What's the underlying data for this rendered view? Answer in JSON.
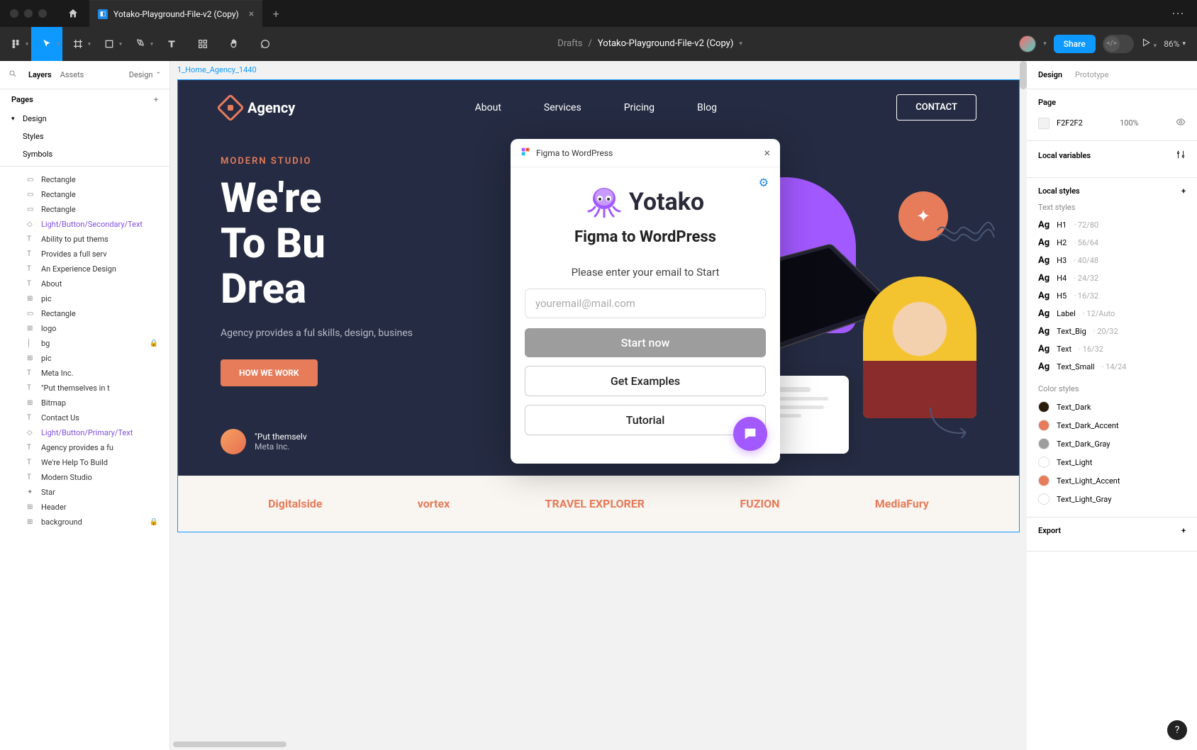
{
  "titlebar": {
    "filename": "Yotako-Playground-File-v2 (Copy)"
  },
  "toolbar": {
    "breadcrumb_root": "Drafts",
    "breadcrumb_sep": "/",
    "filename": "Yotako-Playground-File-v2 (Copy)",
    "share": "Share",
    "zoom": "86%"
  },
  "left_panel": {
    "tabs": {
      "layers": "Layers",
      "assets": "Assets",
      "design": "Design"
    },
    "pages_label": "Pages",
    "pages": [
      {
        "label": "Design",
        "selected": true
      },
      {
        "label": "Styles"
      },
      {
        "label": "Symbols"
      }
    ],
    "layers": [
      {
        "icon": "rect",
        "label": "Rectangle"
      },
      {
        "icon": "rect",
        "label": "Rectangle"
      },
      {
        "icon": "rect",
        "label": "Rectangle"
      },
      {
        "icon": "diamond",
        "label": "Light/Button/Secondary/Text",
        "purple": true
      },
      {
        "icon": "text",
        "label": "Ability to put thems"
      },
      {
        "icon": "text",
        "label": "Provides a full serv"
      },
      {
        "icon": "text",
        "label": "An Experience Design"
      },
      {
        "icon": "text",
        "label": "About"
      },
      {
        "icon": "frame",
        "label": "pic"
      },
      {
        "icon": "rect",
        "label": "Rectangle"
      },
      {
        "icon": "frame",
        "label": "logo"
      },
      {
        "icon": "line",
        "label": "bg",
        "locked": true
      },
      {
        "icon": "frame",
        "label": "pic"
      },
      {
        "icon": "text",
        "label": "Meta Inc."
      },
      {
        "icon": "text",
        "label": "\"Put themselves in t"
      },
      {
        "icon": "frame",
        "label": "Bitmap"
      },
      {
        "icon": "text",
        "label": "Contact Us"
      },
      {
        "icon": "diamond",
        "label": "Light/Button/Primary/Text",
        "purple": true
      },
      {
        "icon": "text",
        "label": "Agency provides a fu"
      },
      {
        "icon": "text",
        "label": "We're Help To Build"
      },
      {
        "icon": "text",
        "label": "Modern Studio"
      },
      {
        "icon": "star",
        "label": "Star"
      },
      {
        "icon": "frame",
        "label": "Header"
      },
      {
        "icon": "frame",
        "label": "background",
        "locked": true
      }
    ]
  },
  "canvas": {
    "frame_label": "1_Home_Agency_1440",
    "nav": {
      "logo": "Agency",
      "links": [
        "About",
        "Services",
        "Pricing",
        "Blog"
      ],
      "contact": "CONTACT"
    },
    "hero": {
      "tag": "MODERN STUDIO",
      "title_l1": "We're",
      "title_l2": "To Bu",
      "title_l3": "Drea",
      "desc": "Agency provides a ful skills, design, busines",
      "cta": "HOW WE WORK"
    },
    "testimonial": {
      "quote": "\"Put themselv",
      "company": "Meta Inc."
    },
    "brands": [
      "Digitalside",
      "vortex",
      "TRAVEL EXPLORER",
      "FUZION",
      "MediaFury"
    ]
  },
  "plugin": {
    "header": "Figma to WordPress",
    "brand": "Yotako",
    "title": "Figma to WordPress",
    "subtitle": "Please enter your email to Start",
    "placeholder": "youremail@mail.com",
    "start": "Start now",
    "examples": "Get Examples",
    "tutorial": "Tutorial"
  },
  "right_panel": {
    "tabs": {
      "design": "Design",
      "prototype": "Prototype"
    },
    "page_label": "Page",
    "bg_hex": "F2F2F2",
    "bg_opacity": "100%",
    "local_vars": "Local variables",
    "local_styles": "Local styles",
    "text_styles_label": "Text styles",
    "text_styles": [
      {
        "name": "H1",
        "meta": "72/80"
      },
      {
        "name": "H2",
        "meta": "56/64"
      },
      {
        "name": "H3",
        "meta": "40/48"
      },
      {
        "name": "H4",
        "meta": "24/32"
      },
      {
        "name": "H5",
        "meta": "16/32"
      },
      {
        "name": "Label",
        "meta": "12/Auto"
      },
      {
        "name": "Text_Big",
        "meta": "20/32"
      },
      {
        "name": "Text",
        "meta": "16/32"
      },
      {
        "name": "Text_Small",
        "meta": "14/24"
      }
    ],
    "color_styles_label": "Color styles",
    "color_styles": [
      {
        "name": "Text_Dark",
        "color": "#2a1a0a"
      },
      {
        "name": "Text_Dark_Accent",
        "color": "#e77c5a"
      },
      {
        "name": "Text_Dark_Gray",
        "color": "#9d9d9d"
      },
      {
        "name": "Text_Light",
        "color": "#ffffff"
      },
      {
        "name": "Text_Light_Accent",
        "color": "#e77c5a"
      },
      {
        "name": "Text_Light_Gray",
        "color": "#ffffff"
      }
    ],
    "export": "Export"
  }
}
